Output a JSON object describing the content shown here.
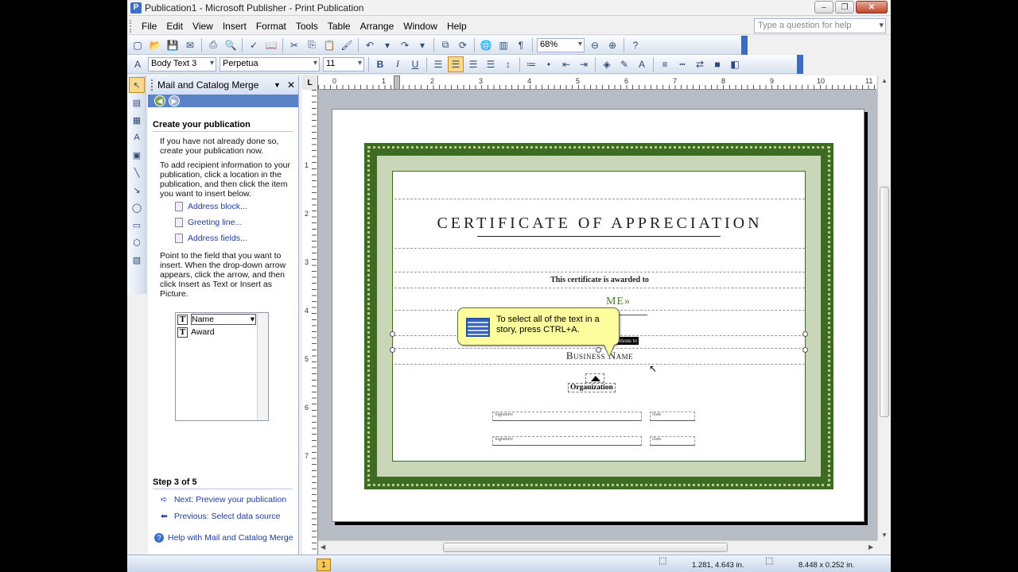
{
  "window": {
    "title": "Publication1 - Microsoft Publisher - Print Publication",
    "app_icon": "P"
  },
  "menu": {
    "items": [
      "File",
      "Edit",
      "View",
      "Insert",
      "Format",
      "Tools",
      "Table",
      "Arrange",
      "Window",
      "Help"
    ],
    "help_placeholder": "Type a question for help"
  },
  "toolbar": {
    "zoom": "68%",
    "style": "Body Text 3",
    "font": "Perpetua",
    "size": "11",
    "bold": "B",
    "italic": "I",
    "underline": "U"
  },
  "taskpane": {
    "title": "Mail and Catalog Merge",
    "section_title": "Create your publication",
    "para1": "If you have not already done so, create your publication now.",
    "para2": "To add recipient information to your publication, click a location in the publication, and then click the item you want to insert below.",
    "links": [
      "Address block...",
      "Greeting line...",
      "Address fields..."
    ],
    "para3": "Point to the field that you want to insert. When the drop-down arrow appears, click the arrow, and then click Insert as Text or Insert as Picture.",
    "fields": [
      "Name",
      "Award"
    ],
    "step": "Step 3 of 5",
    "next": "Next: Preview your publication",
    "previous": "Previous: Select data source",
    "help": "Help with Mail and Catalog Merge"
  },
  "ruler": {
    "corner": "L",
    "h_numbers": [
      "0",
      "1",
      "2",
      "3",
      "4",
      "5",
      "6",
      "7",
      "8",
      "9",
      "10",
      "11"
    ],
    "v_numbers": [
      "1",
      "2",
      "3",
      "4",
      "5",
      "6",
      "7"
    ]
  },
  "certificate": {
    "title": "CERTIFICATE OF APPRECIATION",
    "awarded": "This certificate is awarded to",
    "name_field": "ME»",
    "recognition": "in recognition of valuable contributions to",
    "business": "Business Name",
    "organization": "Organization",
    "signature": "Signature",
    "date": "Date"
  },
  "tooltip": {
    "text": "To select all of the text in a story, press CTRL+A."
  },
  "status": {
    "page": "1",
    "position": "1.281, 4.643 in.",
    "size": "8.448 x  0.252 in."
  }
}
